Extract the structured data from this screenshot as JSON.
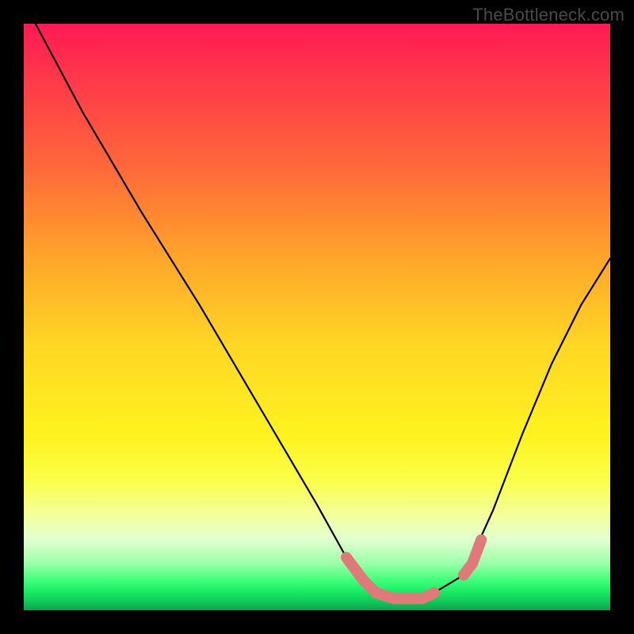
{
  "watermark": "TheBottleneck.com",
  "chart_data": {
    "type": "line",
    "title": "",
    "xlabel": "",
    "ylabel": "",
    "xlim": [
      0,
      100
    ],
    "ylim": [
      0,
      100
    ],
    "series": [
      {
        "name": "bottleneck-curve",
        "x": [
          2,
          10,
          20,
          30,
          40,
          50,
          55,
          58,
          60,
          65,
          68,
          70,
          75,
          80,
          85,
          90,
          95,
          100
        ],
        "y": [
          100,
          85,
          68,
          52,
          35,
          18,
          9,
          5,
          3,
          2,
          2,
          3,
          6,
          17,
          30,
          42,
          52,
          60
        ]
      },
      {
        "name": "highlight-floor",
        "x": [
          55,
          58,
          60,
          63,
          65,
          68,
          70
        ],
        "y": [
          9,
          5,
          3,
          2,
          2,
          2,
          3
        ]
      },
      {
        "name": "highlight-right",
        "x": [
          75,
          76.5,
          78
        ],
        "y": [
          6,
          8,
          12
        ]
      }
    ]
  }
}
